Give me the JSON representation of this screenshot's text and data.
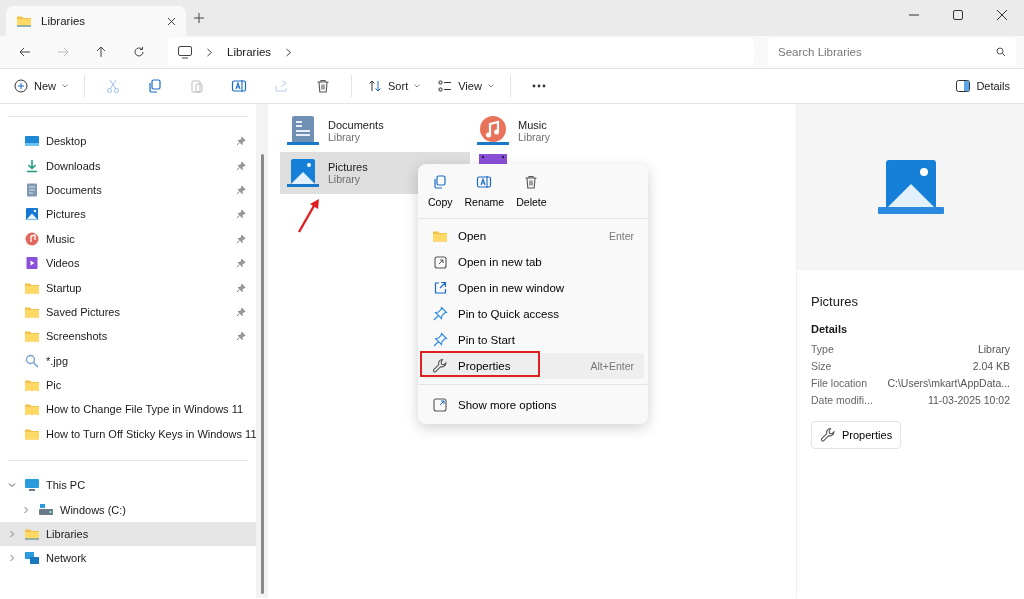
{
  "window": {
    "tab_title": "Libraries"
  },
  "nav": {
    "breadcrumb": [
      "Libraries"
    ],
    "search_placeholder": "Search Libraries"
  },
  "toolbar": {
    "new_label": "New",
    "sort_label": "Sort",
    "view_label": "View",
    "details_label": "Details"
  },
  "sidebar": {
    "quick_access": [
      {
        "label": "Desktop",
        "kind": "desktop",
        "pinned": true,
        "selected": false
      },
      {
        "label": "Downloads",
        "kind": "download",
        "pinned": true,
        "selected": false
      },
      {
        "label": "Documents",
        "kind": "document",
        "pinned": true,
        "selected": false
      },
      {
        "label": "Pictures",
        "kind": "pictures",
        "pinned": true,
        "selected": false
      },
      {
        "label": "Music",
        "kind": "music",
        "pinned": true,
        "selected": false
      },
      {
        "label": "Videos",
        "kind": "videos",
        "pinned": true,
        "selected": false
      },
      {
        "label": "Startup",
        "kind": "folder",
        "pinned": true,
        "selected": false
      },
      {
        "label": "Saved Pictures",
        "kind": "folder",
        "pinned": true,
        "selected": false
      },
      {
        "label": "Screenshots",
        "kind": "folder",
        "pinned": true,
        "selected": false
      },
      {
        "label": "*.jpg",
        "kind": "search",
        "pinned": false,
        "selected": false
      },
      {
        "label": "Pic",
        "kind": "folder",
        "pinned": false,
        "selected": false
      },
      {
        "label": "How to Change File Type in Windows 11",
        "kind": "folder",
        "pinned": false,
        "selected": false
      },
      {
        "label": "How to Turn Off Sticky Keys in Windows 11",
        "kind": "folder",
        "pinned": false,
        "selected": false
      }
    ],
    "tree": [
      {
        "label": "This PC",
        "kind": "pc",
        "expanded": true,
        "selected": false,
        "children": [
          {
            "label": "Windows (C:)",
            "kind": "drive",
            "expanded": false,
            "selected": false
          }
        ]
      },
      {
        "label": "Libraries",
        "kind": "library",
        "expanded": false,
        "selected": true
      },
      {
        "label": "Network",
        "kind": "network",
        "expanded": false,
        "selected": false
      }
    ]
  },
  "libraries": [
    {
      "name": "Documents",
      "subtitle": "Library",
      "kind": "document",
      "selected": false
    },
    {
      "name": "Music",
      "subtitle": "Library",
      "kind": "music",
      "selected": false
    },
    {
      "name": "Pictures",
      "subtitle": "Library",
      "kind": "pictures",
      "selected": true
    },
    {
      "kind": "videos",
      "selected": false
    }
  ],
  "context_menu": {
    "actions": [
      {
        "label": "Copy",
        "kind": "copy"
      },
      {
        "label": "Rename",
        "kind": "rename"
      },
      {
        "label": "Delete",
        "kind": "delete"
      }
    ],
    "items": [
      {
        "label": "Open",
        "kind": "folder",
        "shortcut": "Enter",
        "hover": false,
        "annotated": false
      },
      {
        "label": "Open in new tab",
        "kind": "newtab",
        "hover": false,
        "annotated": false
      },
      {
        "label": "Open in new window",
        "kind": "newwindow",
        "hover": false,
        "annotated": false
      },
      {
        "label": "Pin to Quick access",
        "kind": "pin",
        "hover": false,
        "annotated": false
      },
      {
        "label": "Pin to Start",
        "kind": "pin",
        "hover": false,
        "annotated": false
      },
      {
        "label": "Properties",
        "kind": "wrench",
        "shortcut": "Alt+Enter",
        "hover": true,
        "annotated": true
      },
      {
        "label": "Show more options",
        "kind": "more",
        "hover": false,
        "annotated": false
      }
    ]
  },
  "details": {
    "title": "Pictures",
    "heading": "Details",
    "rows": [
      {
        "label": "Type",
        "value": "Library"
      },
      {
        "label": "Size",
        "value": "2.04 KB"
      },
      {
        "label": "File location",
        "value": "C:\\Users\\mkart\\AppData..."
      },
      {
        "label": "Date modifi...",
        "value": "11-03-2025 10:02"
      }
    ],
    "button": "Properties"
  }
}
